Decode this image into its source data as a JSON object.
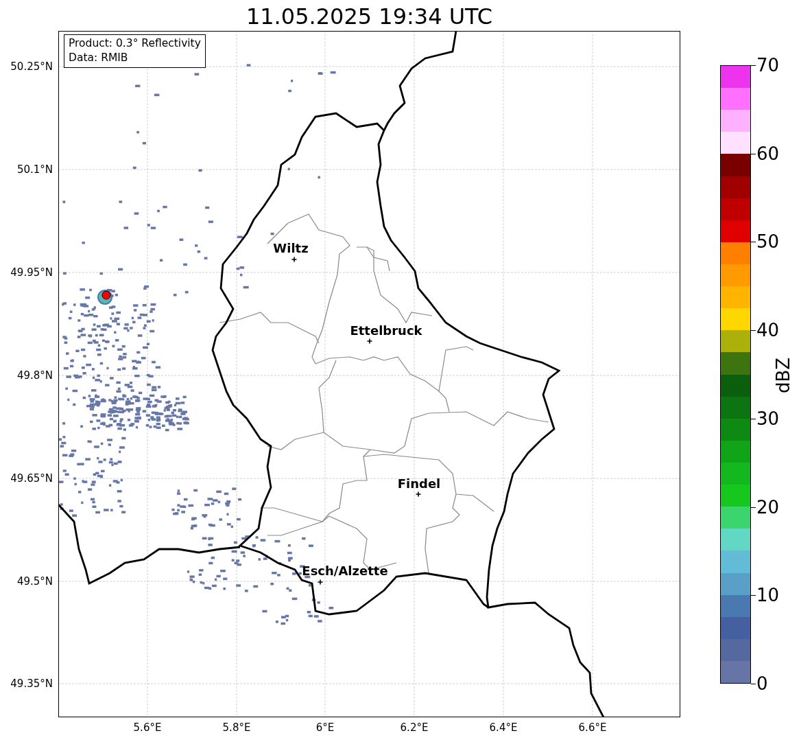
{
  "title": "11.05.2025 19:34 UTC",
  "info_box": [
    "Product: 0.3° Reflectivity",
    "Data: RMIB"
  ],
  "y_ticks": [
    "50.25°N",
    "50.1°N",
    "49.95°N",
    "49.8°N",
    "49.65°N",
    "49.5°N",
    "49.35°N"
  ],
  "x_ticks": [
    "5.6°E",
    "5.8°E",
    "6°E",
    "6.2°E",
    "6.4°E",
    "6.6°E"
  ],
  "cities": [
    {
      "name": "Wiltz"
    },
    {
      "name": "Ettelbruck"
    },
    {
      "name": "Findel"
    },
    {
      "name": "Esch/Alzette"
    }
  ],
  "colorbar": {
    "label": "dBZ",
    "ticks": [
      "70",
      "60",
      "50",
      "40",
      "30",
      "20",
      "10",
      "0"
    ],
    "bins": [
      {
        "color": "#ee33ee"
      },
      {
        "color": "#ff70ff"
      },
      {
        "color": "#ffb0ff"
      },
      {
        "color": "#ffe0ff"
      },
      {
        "color": "#7a0000"
      },
      {
        "color": "#a00000"
      },
      {
        "color": "#c00000"
      },
      {
        "color": "#e00000"
      },
      {
        "color": "#ff7f00"
      },
      {
        "color": "#ff9a00"
      },
      {
        "color": "#ffb400"
      },
      {
        "color": "#ffd700"
      },
      {
        "color": "#acb00a"
      },
      {
        "color": "#3e7410"
      },
      {
        "color": "#0a5e0c"
      },
      {
        "color": "#0c7410"
      },
      {
        "color": "#0e8a14"
      },
      {
        "color": "#10a418"
      },
      {
        "color": "#12b81e"
      },
      {
        "color": "#16c81e"
      },
      {
        "color": "#3cd46c"
      },
      {
        "color": "#62d8c4"
      },
      {
        "color": "#62bcd8"
      },
      {
        "color": "#5a9fc8"
      },
      {
        "color": "#4a78b0"
      },
      {
        "color": "#4560a0"
      },
      {
        "color": "#5568a0"
      },
      {
        "color": "#6675a6"
      }
    ]
  }
}
